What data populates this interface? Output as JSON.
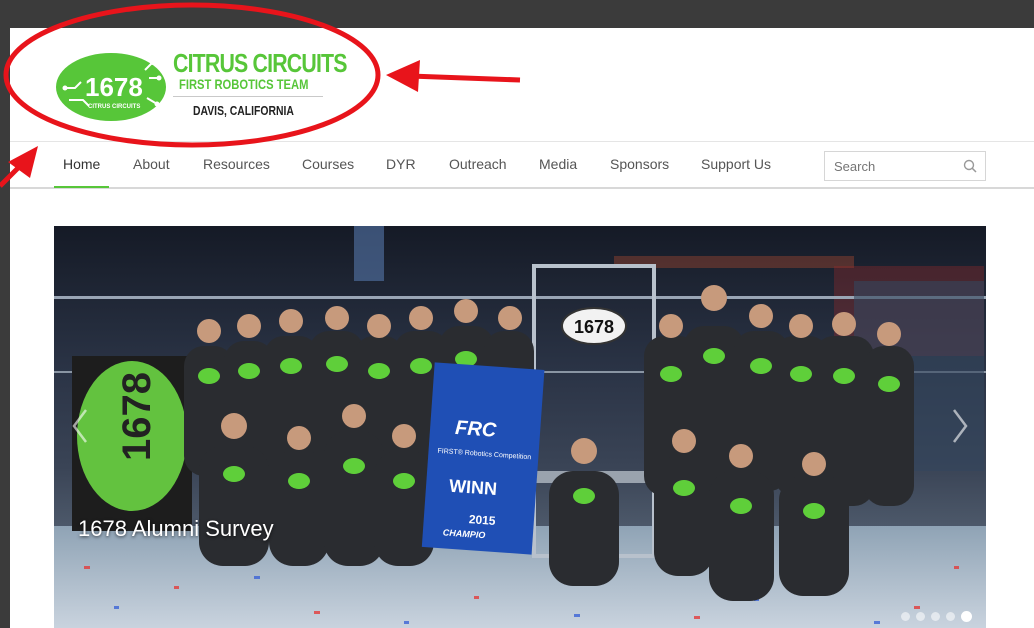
{
  "logo": {
    "team_number": "1678",
    "bean_caption": "CITRUS CIRCUITS",
    "title": "CITRUS CIRCUITS",
    "subtitle": "FIRST ROBOTICS TEAM",
    "location": "DAVIS, CALIFORNIA"
  },
  "nav": {
    "items": [
      {
        "label": "Home",
        "active": true
      },
      {
        "label": "About"
      },
      {
        "label": "Resources"
      },
      {
        "label": "Courses"
      },
      {
        "label": "DYR"
      },
      {
        "label": "Outreach"
      },
      {
        "label": "Media"
      },
      {
        "label": "Sponsors"
      },
      {
        "label": "Support Us"
      }
    ],
    "search_placeholder": "Search"
  },
  "carousel": {
    "caption": "1678 Alumni Survey",
    "slide_count": 5,
    "active_slide": 5,
    "photo_text": {
      "team_sign": "1678",
      "banner_logo": "FRC",
      "banner_line": "FIRST® Robotics Competition",
      "banner_winner": "WINN",
      "banner_year": "2015",
      "banner_champ": "CHAMPIO",
      "flag_number": "1678"
    }
  },
  "colors": {
    "brand_green": "#57c639",
    "annotation_red": "#e8141b",
    "background_dark": "#3b3b3b"
  }
}
